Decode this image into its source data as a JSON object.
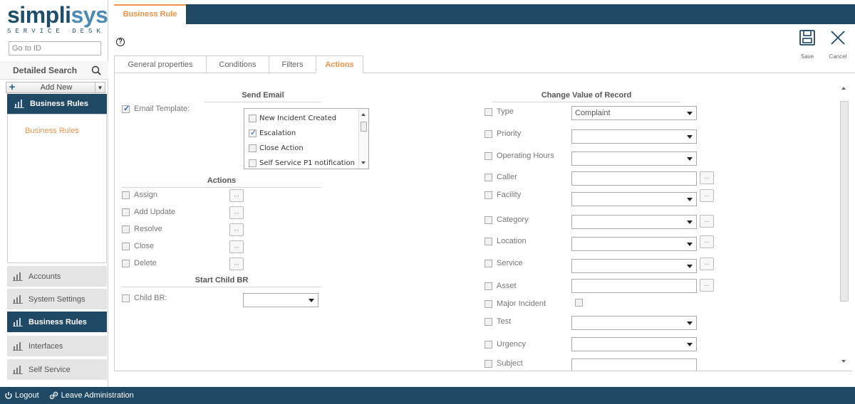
{
  "brand": {
    "name_part1": "simpli",
    "name_part2": "sys",
    "tagline": "SERVICE DESK"
  },
  "sidebar": {
    "goto_placeholder": "Go to ID",
    "detailed_search": "Detailed Search",
    "add_new": "Add New",
    "current_group": "Business Rules",
    "panel_items": [
      "Business Rules"
    ],
    "nav": [
      "Accounts",
      "System Settings",
      "Business Rules",
      "Interfaces",
      "Self Service"
    ]
  },
  "header": {
    "tab": "Business Rule",
    "help": "?"
  },
  "toolbar": {
    "save_label": "Save",
    "cancel_label": "Cancel"
  },
  "tabs": [
    "General properties",
    "Conditions",
    "Filters",
    "Actions"
  ],
  "send_email": {
    "title": "Send Email",
    "email_template_label": "Email Template:",
    "email_template_checked": true,
    "templates": [
      {
        "label": "New Incident Created",
        "checked": false
      },
      {
        "label": "Escalation",
        "checked": true
      },
      {
        "label": "Close Action",
        "checked": false
      },
      {
        "label": "Self Service P1 notification",
        "checked": false
      }
    ]
  },
  "actions": {
    "title": "Actions",
    "items": [
      "Assign",
      "Add Update",
      "Resolve",
      "Close",
      "Delete"
    ],
    "ellipsis": "..."
  },
  "start_child": {
    "title": "Start Child BR",
    "label": "Child BR:",
    "value": ""
  },
  "change_value": {
    "title": "Change Value of Record",
    "fields": [
      {
        "label": "Type",
        "control": "select",
        "value": "Complaint"
      },
      {
        "label": "Priority",
        "control": "select",
        "value": ""
      },
      {
        "label": "Operating Hours",
        "control": "select",
        "value": ""
      },
      {
        "label": "Caller",
        "control": "text",
        "value": ""
      },
      {
        "label": "Facility",
        "control": "select-ellipsis",
        "value": ""
      },
      {
        "label": "Category",
        "control": "select-ellipsis",
        "value": ""
      },
      {
        "label": "Location",
        "control": "select-ellipsis",
        "value": ""
      },
      {
        "label": "Service",
        "control": "select-ellipsis",
        "value": ""
      },
      {
        "label": "Asset",
        "control": "text",
        "value": ""
      },
      {
        "label": "Major Incident",
        "control": "checkbox",
        "value": ""
      },
      {
        "label": "Test",
        "control": "select",
        "value": ""
      },
      {
        "label": "Urgency",
        "control": "select",
        "value": ""
      },
      {
        "label": "Subject",
        "control": "text",
        "value": ""
      }
    ]
  },
  "footer": {
    "logout": "Logout",
    "leave_admin": "Leave Administration"
  }
}
